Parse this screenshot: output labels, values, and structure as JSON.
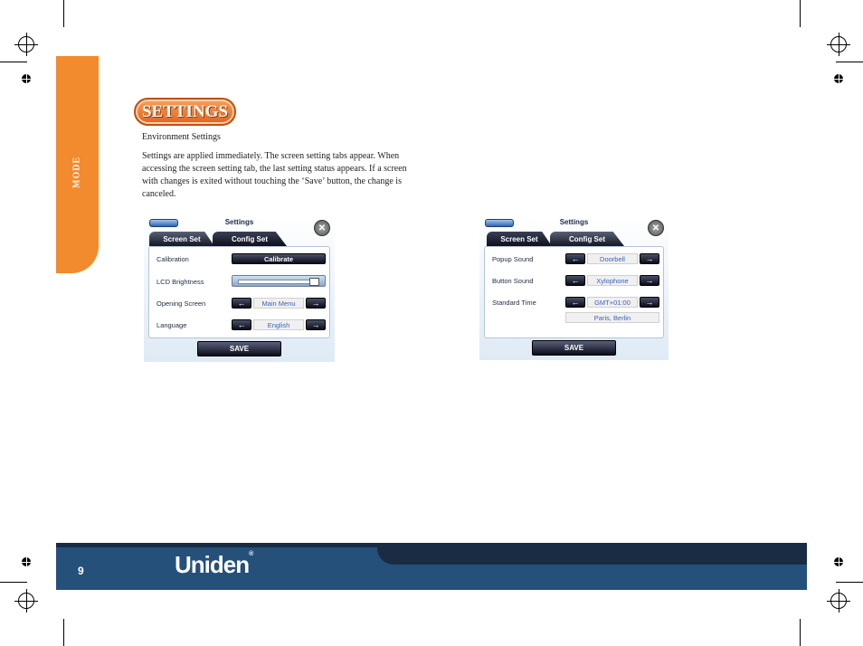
{
  "side_tab": {
    "label": "MODE"
  },
  "heading": {
    "title": "SETTINGS"
  },
  "subheading": "Environment Settings",
  "body": {
    "line1": "Settings are applied immediately. The screen setting tabs appear. When",
    "line2": "accessing the screen setting tab, the last setting status appears. If a screen",
    "line3": "with changes is exited without touching the ‘Save’ button, the change is",
    "line4": "canceled."
  },
  "screen_left": {
    "title": "Settings",
    "close": "✕",
    "tabs": [
      "Screen Set",
      "Config Set"
    ],
    "rows": {
      "calibration": {
        "label": "Calibration",
        "button": "Calibrate"
      },
      "brightness": {
        "label": "LCD Brightness",
        "level": 0.95
      },
      "opening": {
        "label": "Opening Screen",
        "value": "Main Menu"
      },
      "language": {
        "label": "Language",
        "value": "English"
      }
    },
    "arrow_left": "←",
    "arrow_right": "→",
    "save": "SAVE"
  },
  "screen_right": {
    "title": "Settings",
    "close": "✕",
    "tabs": [
      "Screen Set",
      "Config Set"
    ],
    "rows": {
      "popup": {
        "label": "Popup Sound",
        "value": "Doorbell"
      },
      "button": {
        "label": "Button Sound",
        "value": "Xylophone"
      },
      "time": {
        "label": "Standard Time",
        "value": "GMT+01:00",
        "city": "Paris, Berlin"
      }
    },
    "arrow_left": "←",
    "arrow_right": "→",
    "save": "SAVE"
  },
  "footer": {
    "page_number": "9",
    "logo": "Uniden",
    "trademark": "®"
  },
  "colors": {
    "orange": "#f28a2e",
    "footer_blue": "#25507a",
    "footer_dark": "#1a2b44"
  }
}
